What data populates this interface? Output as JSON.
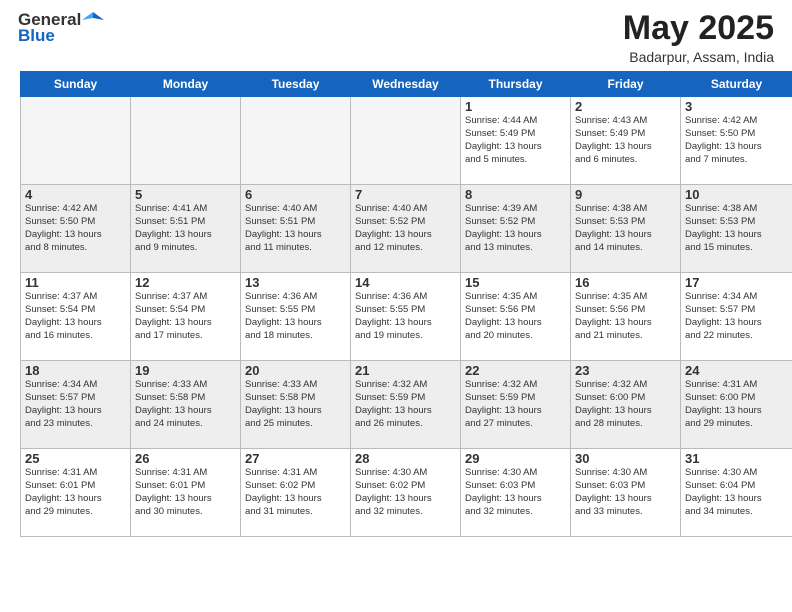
{
  "header": {
    "logo": {
      "general": "General",
      "blue": "Blue",
      "tagline": "GeneralBlue"
    },
    "title": "May 2025",
    "location": "Badarpur, Assam, India"
  },
  "calendar": {
    "days": [
      "Sunday",
      "Monday",
      "Tuesday",
      "Wednesday",
      "Thursday",
      "Friday",
      "Saturday"
    ],
    "weeks": [
      [
        {
          "num": "",
          "text": "",
          "empty": true
        },
        {
          "num": "",
          "text": "",
          "empty": true
        },
        {
          "num": "",
          "text": "",
          "empty": true
        },
        {
          "num": "",
          "text": "",
          "empty": true
        },
        {
          "num": "1",
          "text": "Sunrise: 4:44 AM\nSunset: 5:49 PM\nDaylight: 13 hours\nand 5 minutes."
        },
        {
          "num": "2",
          "text": "Sunrise: 4:43 AM\nSunset: 5:49 PM\nDaylight: 13 hours\nand 6 minutes."
        },
        {
          "num": "3",
          "text": "Sunrise: 4:42 AM\nSunset: 5:50 PM\nDaylight: 13 hours\nand 7 minutes."
        }
      ],
      [
        {
          "num": "4",
          "text": "Sunrise: 4:42 AM\nSunset: 5:50 PM\nDaylight: 13 hours\nand 8 minutes."
        },
        {
          "num": "5",
          "text": "Sunrise: 4:41 AM\nSunset: 5:51 PM\nDaylight: 13 hours\nand 9 minutes."
        },
        {
          "num": "6",
          "text": "Sunrise: 4:40 AM\nSunset: 5:51 PM\nDaylight: 13 hours\nand 11 minutes."
        },
        {
          "num": "7",
          "text": "Sunrise: 4:40 AM\nSunset: 5:52 PM\nDaylight: 13 hours\nand 12 minutes."
        },
        {
          "num": "8",
          "text": "Sunrise: 4:39 AM\nSunset: 5:52 PM\nDaylight: 13 hours\nand 13 minutes."
        },
        {
          "num": "9",
          "text": "Sunrise: 4:38 AM\nSunset: 5:53 PM\nDaylight: 13 hours\nand 14 minutes."
        },
        {
          "num": "10",
          "text": "Sunrise: 4:38 AM\nSunset: 5:53 PM\nDaylight: 13 hours\nand 15 minutes."
        }
      ],
      [
        {
          "num": "11",
          "text": "Sunrise: 4:37 AM\nSunset: 5:54 PM\nDaylight: 13 hours\nand 16 minutes."
        },
        {
          "num": "12",
          "text": "Sunrise: 4:37 AM\nSunset: 5:54 PM\nDaylight: 13 hours\nand 17 minutes."
        },
        {
          "num": "13",
          "text": "Sunrise: 4:36 AM\nSunset: 5:55 PM\nDaylight: 13 hours\nand 18 minutes."
        },
        {
          "num": "14",
          "text": "Sunrise: 4:36 AM\nSunset: 5:55 PM\nDaylight: 13 hours\nand 19 minutes."
        },
        {
          "num": "15",
          "text": "Sunrise: 4:35 AM\nSunset: 5:56 PM\nDaylight: 13 hours\nand 20 minutes."
        },
        {
          "num": "16",
          "text": "Sunrise: 4:35 AM\nSunset: 5:56 PM\nDaylight: 13 hours\nand 21 minutes."
        },
        {
          "num": "17",
          "text": "Sunrise: 4:34 AM\nSunset: 5:57 PM\nDaylight: 13 hours\nand 22 minutes."
        }
      ],
      [
        {
          "num": "18",
          "text": "Sunrise: 4:34 AM\nSunset: 5:57 PM\nDaylight: 13 hours\nand 23 minutes."
        },
        {
          "num": "19",
          "text": "Sunrise: 4:33 AM\nSunset: 5:58 PM\nDaylight: 13 hours\nand 24 minutes."
        },
        {
          "num": "20",
          "text": "Sunrise: 4:33 AM\nSunset: 5:58 PM\nDaylight: 13 hours\nand 25 minutes."
        },
        {
          "num": "21",
          "text": "Sunrise: 4:32 AM\nSunset: 5:59 PM\nDaylight: 13 hours\nand 26 minutes."
        },
        {
          "num": "22",
          "text": "Sunrise: 4:32 AM\nSunset: 5:59 PM\nDaylight: 13 hours\nand 27 minutes."
        },
        {
          "num": "23",
          "text": "Sunrise: 4:32 AM\nSunset: 6:00 PM\nDaylight: 13 hours\nand 28 minutes."
        },
        {
          "num": "24",
          "text": "Sunrise: 4:31 AM\nSunset: 6:00 PM\nDaylight: 13 hours\nand 29 minutes."
        }
      ],
      [
        {
          "num": "25",
          "text": "Sunrise: 4:31 AM\nSunset: 6:01 PM\nDaylight: 13 hours\nand 29 minutes."
        },
        {
          "num": "26",
          "text": "Sunrise: 4:31 AM\nSunset: 6:01 PM\nDaylight: 13 hours\nand 30 minutes."
        },
        {
          "num": "27",
          "text": "Sunrise: 4:31 AM\nSunset: 6:02 PM\nDaylight: 13 hours\nand 31 minutes."
        },
        {
          "num": "28",
          "text": "Sunrise: 4:30 AM\nSunset: 6:02 PM\nDaylight: 13 hours\nand 32 minutes."
        },
        {
          "num": "29",
          "text": "Sunrise: 4:30 AM\nSunset: 6:03 PM\nDaylight: 13 hours\nand 32 minutes."
        },
        {
          "num": "30",
          "text": "Sunrise: 4:30 AM\nSunset: 6:03 PM\nDaylight: 13 hours\nand 33 minutes."
        },
        {
          "num": "31",
          "text": "Sunrise: 4:30 AM\nSunset: 6:04 PM\nDaylight: 13 hours\nand 34 minutes."
        }
      ]
    ]
  }
}
